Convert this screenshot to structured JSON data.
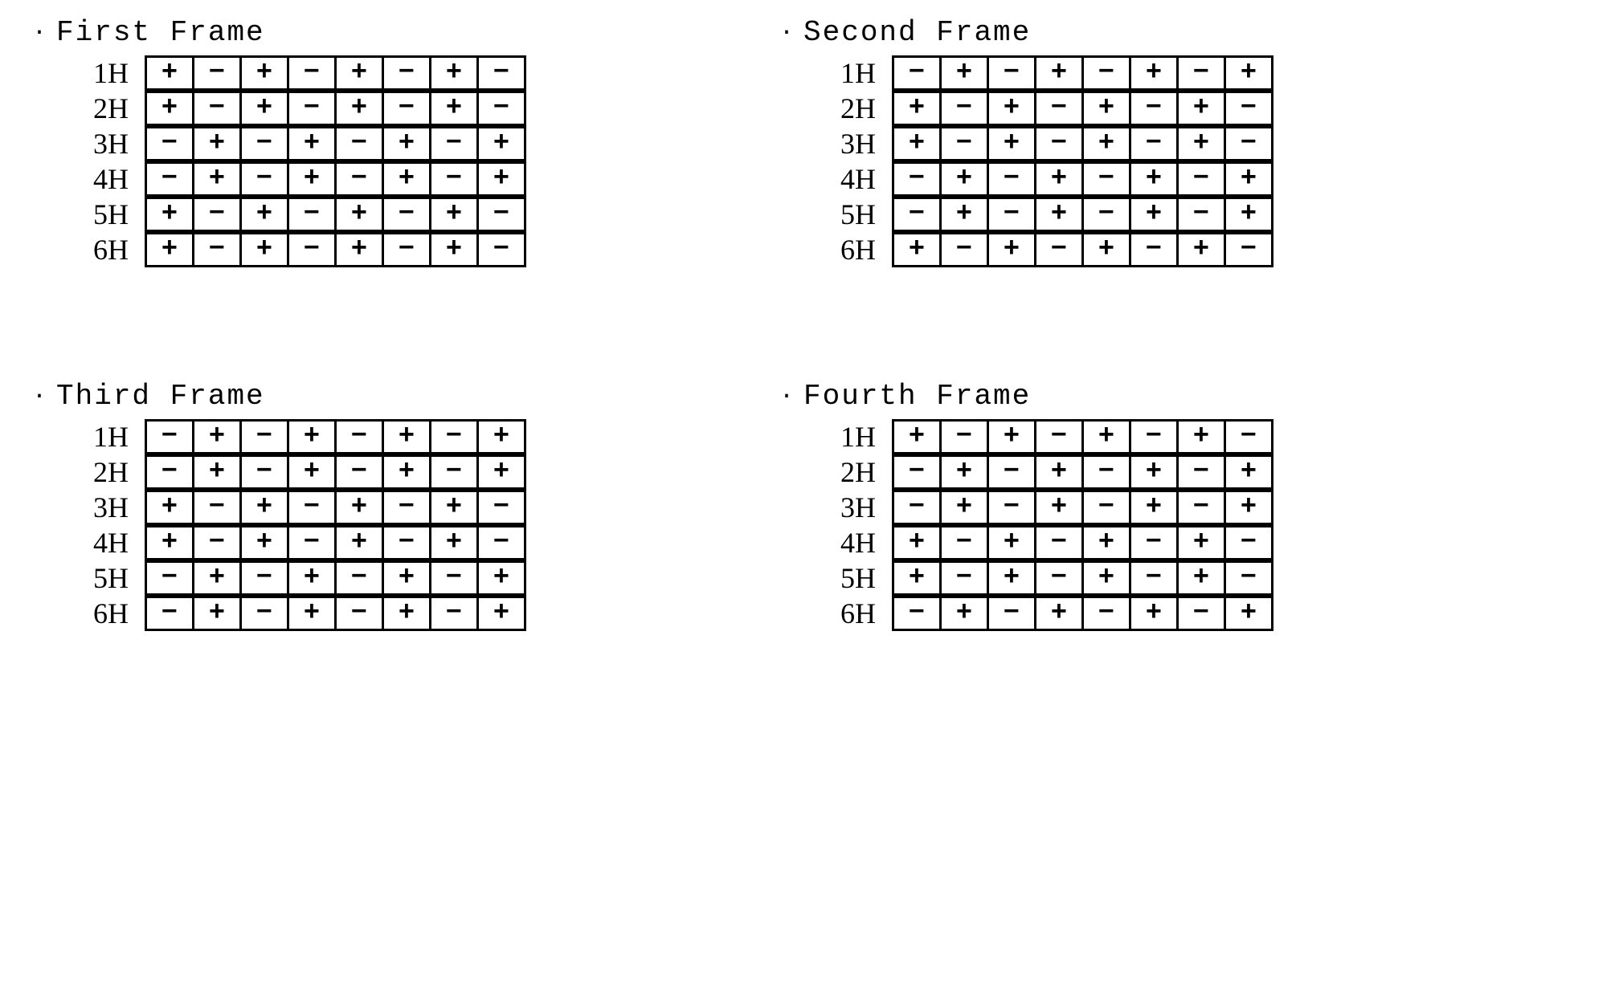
{
  "bullet": "·",
  "row_labels": [
    "1H",
    "2H",
    "3H",
    "4H",
    "5H",
    "6H"
  ],
  "frames": [
    {
      "title": "First Frame",
      "rows": [
        [
          "+",
          "−",
          "+",
          "−",
          "+",
          "−",
          "+",
          "−"
        ],
        [
          "+",
          "−",
          "+",
          "−",
          "+",
          "−",
          "+",
          "−"
        ],
        [
          "−",
          "+",
          "−",
          "+",
          "−",
          "+",
          "−",
          "+"
        ],
        [
          "−",
          "+",
          "−",
          "+",
          "−",
          "+",
          "−",
          "+"
        ],
        [
          "+",
          "−",
          "+",
          "−",
          "+",
          "−",
          "+",
          "−"
        ],
        [
          "+",
          "−",
          "+",
          "−",
          "+",
          "−",
          "+",
          "−"
        ]
      ]
    },
    {
      "title": "Second Frame",
      "rows": [
        [
          "−",
          "+",
          "−",
          "+",
          "−",
          "+",
          "−",
          "+"
        ],
        [
          "+",
          "−",
          "+",
          "−",
          "+",
          "−",
          "+",
          "−"
        ],
        [
          "+",
          "−",
          "+",
          "−",
          "+",
          "−",
          "+",
          "−"
        ],
        [
          "−",
          "+",
          "−",
          "+",
          "−",
          "+",
          "−",
          "+"
        ],
        [
          "−",
          "+",
          "−",
          "+",
          "−",
          "+",
          "−",
          "+"
        ],
        [
          "+",
          "−",
          "+",
          "−",
          "+",
          "−",
          "+",
          "−"
        ]
      ]
    },
    {
      "title": "Third Frame",
      "rows": [
        [
          "−",
          "+",
          "−",
          "+",
          "−",
          "+",
          "−",
          "+"
        ],
        [
          "−",
          "+",
          "−",
          "+",
          "−",
          "+",
          "−",
          "+"
        ],
        [
          "+",
          "−",
          "+",
          "−",
          "+",
          "−",
          "+",
          "−"
        ],
        [
          "+",
          "−",
          "+",
          "−",
          "+",
          "−",
          "+",
          "−"
        ],
        [
          "−",
          "+",
          "−",
          "+",
          "−",
          "+",
          "−",
          "+"
        ],
        [
          "−",
          "+",
          "−",
          "+",
          "−",
          "+",
          "−",
          "+"
        ]
      ]
    },
    {
      "title": "Fourth Frame",
      "rows": [
        [
          "+",
          "−",
          "+",
          "−",
          "+",
          "−",
          "+",
          "−"
        ],
        [
          "−",
          "+",
          "−",
          "+",
          "−",
          "+",
          "−",
          "+"
        ],
        [
          "−",
          "+",
          "−",
          "+",
          "−",
          "+",
          "−",
          "+"
        ],
        [
          "+",
          "−",
          "+",
          "−",
          "+",
          "−",
          "+",
          "−"
        ],
        [
          "+",
          "−",
          "+",
          "−",
          "+",
          "−",
          "+",
          "−"
        ],
        [
          "−",
          "+",
          "−",
          "+",
          "−",
          "+",
          "−",
          "+"
        ]
      ]
    }
  ]
}
